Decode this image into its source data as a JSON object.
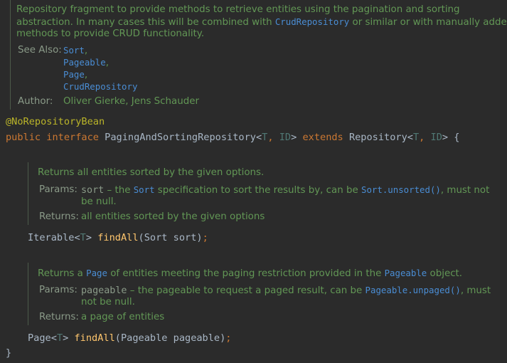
{
  "class_doc": {
    "line1": "Repository fragment to provide methods to retrieve entities using the pagination and sorting",
    "line2_a": "abstraction. In many cases this will be combined with ",
    "line2_link": "CrudRepository",
    "line2_b": " or similar or with manually added",
    "line3": "methods to provide CRUD functionality.",
    "see_also_label": "See Also:",
    "see_also": [
      "Sort",
      "Pageable",
      "Page",
      "CrudRepository"
    ],
    "author_label": "Author:",
    "author": "Oliver Gierke, Jens Schauder"
  },
  "code": {
    "annotation": "@NoRepositoryBean",
    "kw_public": "public",
    "kw_interface": "interface",
    "iface_name": "PagingAndSortingRepository",
    "lt": "<",
    "t": "T",
    "comma": ", ",
    "id": "ID",
    "gt": ">",
    "kw_extends": "extends",
    "parent": "Repository",
    "open_brace": "{",
    "close_brace": "}"
  },
  "method1": {
    "summary": "Returns all entities sorted by the given options.",
    "params_label": "Params:",
    "param_name": "sort",
    "param_a": " – the ",
    "param_link1": "Sort",
    "param_b": " specification to sort the results by, can be ",
    "param_link2": "Sort.unsorted()",
    "param_c": ", must not",
    "param_cont": "be null.",
    "returns_label": "Returns:",
    "returns": "all entities sorted by the given options",
    "sig_type": "Iterable",
    "sig_fn": "findAll",
    "sig_args": "(Sort sort)",
    "sig_semi": ";"
  },
  "method2": {
    "summary_a": "Returns a ",
    "summary_link1": "Page",
    "summary_b": " of entities meeting the paging restriction provided in the ",
    "summary_link2": "Pageable",
    "summary_c": " object.",
    "params_label": "Params:",
    "param_name": "pageable",
    "param_a": " – the pageable to request a paged result, can be ",
    "param_link": "Pageable.unpaged()",
    "param_c": ", must",
    "param_cont": "not be null.",
    "returns_label": "Returns:",
    "returns": "a page of entities",
    "sig_type": "Page",
    "sig_fn": "findAll",
    "sig_args": "(Pageable pageable)",
    "sig_semi": ";"
  }
}
